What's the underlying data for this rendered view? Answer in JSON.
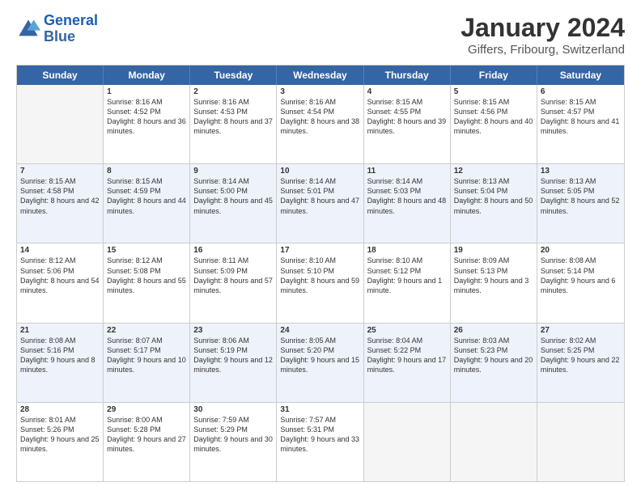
{
  "header": {
    "logo_line1": "General",
    "logo_line2": "Blue",
    "title": "January 2024",
    "subtitle": "Giffers, Fribourg, Switzerland"
  },
  "calendar": {
    "days": [
      "Sunday",
      "Monday",
      "Tuesday",
      "Wednesday",
      "Thursday",
      "Friday",
      "Saturday"
    ],
    "rows": [
      [
        {
          "num": "",
          "sunrise": "",
          "sunset": "",
          "daylight": "",
          "empty": true
        },
        {
          "num": "1",
          "sunrise": "Sunrise: 8:16 AM",
          "sunset": "Sunset: 4:52 PM",
          "daylight": "Daylight: 8 hours and 36 minutes."
        },
        {
          "num": "2",
          "sunrise": "Sunrise: 8:16 AM",
          "sunset": "Sunset: 4:53 PM",
          "daylight": "Daylight: 8 hours and 37 minutes."
        },
        {
          "num": "3",
          "sunrise": "Sunrise: 8:16 AM",
          "sunset": "Sunset: 4:54 PM",
          "daylight": "Daylight: 8 hours and 38 minutes."
        },
        {
          "num": "4",
          "sunrise": "Sunrise: 8:15 AM",
          "sunset": "Sunset: 4:55 PM",
          "daylight": "Daylight: 8 hours and 39 minutes."
        },
        {
          "num": "5",
          "sunrise": "Sunrise: 8:15 AM",
          "sunset": "Sunset: 4:56 PM",
          "daylight": "Daylight: 8 hours and 40 minutes."
        },
        {
          "num": "6",
          "sunrise": "Sunrise: 8:15 AM",
          "sunset": "Sunset: 4:57 PM",
          "daylight": "Daylight: 8 hours and 41 minutes."
        }
      ],
      [
        {
          "num": "7",
          "sunrise": "Sunrise: 8:15 AM",
          "sunset": "Sunset: 4:58 PM",
          "daylight": "Daylight: 8 hours and 42 minutes."
        },
        {
          "num": "8",
          "sunrise": "Sunrise: 8:15 AM",
          "sunset": "Sunset: 4:59 PM",
          "daylight": "Daylight: 8 hours and 44 minutes."
        },
        {
          "num": "9",
          "sunrise": "Sunrise: 8:14 AM",
          "sunset": "Sunset: 5:00 PM",
          "daylight": "Daylight: 8 hours and 45 minutes."
        },
        {
          "num": "10",
          "sunrise": "Sunrise: 8:14 AM",
          "sunset": "Sunset: 5:01 PM",
          "daylight": "Daylight: 8 hours and 47 minutes."
        },
        {
          "num": "11",
          "sunrise": "Sunrise: 8:14 AM",
          "sunset": "Sunset: 5:03 PM",
          "daylight": "Daylight: 8 hours and 48 minutes."
        },
        {
          "num": "12",
          "sunrise": "Sunrise: 8:13 AM",
          "sunset": "Sunset: 5:04 PM",
          "daylight": "Daylight: 8 hours and 50 minutes."
        },
        {
          "num": "13",
          "sunrise": "Sunrise: 8:13 AM",
          "sunset": "Sunset: 5:05 PM",
          "daylight": "Daylight: 8 hours and 52 minutes."
        }
      ],
      [
        {
          "num": "14",
          "sunrise": "Sunrise: 8:12 AM",
          "sunset": "Sunset: 5:06 PM",
          "daylight": "Daylight: 8 hours and 54 minutes."
        },
        {
          "num": "15",
          "sunrise": "Sunrise: 8:12 AM",
          "sunset": "Sunset: 5:08 PM",
          "daylight": "Daylight: 8 hours and 55 minutes."
        },
        {
          "num": "16",
          "sunrise": "Sunrise: 8:11 AM",
          "sunset": "Sunset: 5:09 PM",
          "daylight": "Daylight: 8 hours and 57 minutes."
        },
        {
          "num": "17",
          "sunrise": "Sunrise: 8:10 AM",
          "sunset": "Sunset: 5:10 PM",
          "daylight": "Daylight: 8 hours and 59 minutes."
        },
        {
          "num": "18",
          "sunrise": "Sunrise: 8:10 AM",
          "sunset": "Sunset: 5:12 PM",
          "daylight": "Daylight: 9 hours and 1 minute."
        },
        {
          "num": "19",
          "sunrise": "Sunrise: 8:09 AM",
          "sunset": "Sunset: 5:13 PM",
          "daylight": "Daylight: 9 hours and 3 minutes."
        },
        {
          "num": "20",
          "sunrise": "Sunrise: 8:08 AM",
          "sunset": "Sunset: 5:14 PM",
          "daylight": "Daylight: 9 hours and 6 minutes."
        }
      ],
      [
        {
          "num": "21",
          "sunrise": "Sunrise: 8:08 AM",
          "sunset": "Sunset: 5:16 PM",
          "daylight": "Daylight: 9 hours and 8 minutes."
        },
        {
          "num": "22",
          "sunrise": "Sunrise: 8:07 AM",
          "sunset": "Sunset: 5:17 PM",
          "daylight": "Daylight: 9 hours and 10 minutes."
        },
        {
          "num": "23",
          "sunrise": "Sunrise: 8:06 AM",
          "sunset": "Sunset: 5:19 PM",
          "daylight": "Daylight: 9 hours and 12 minutes."
        },
        {
          "num": "24",
          "sunrise": "Sunrise: 8:05 AM",
          "sunset": "Sunset: 5:20 PM",
          "daylight": "Daylight: 9 hours and 15 minutes."
        },
        {
          "num": "25",
          "sunrise": "Sunrise: 8:04 AM",
          "sunset": "Sunset: 5:22 PM",
          "daylight": "Daylight: 9 hours and 17 minutes."
        },
        {
          "num": "26",
          "sunrise": "Sunrise: 8:03 AM",
          "sunset": "Sunset: 5:23 PM",
          "daylight": "Daylight: 9 hours and 20 minutes."
        },
        {
          "num": "27",
          "sunrise": "Sunrise: 8:02 AM",
          "sunset": "Sunset: 5:25 PM",
          "daylight": "Daylight: 9 hours and 22 minutes."
        }
      ],
      [
        {
          "num": "28",
          "sunrise": "Sunrise: 8:01 AM",
          "sunset": "Sunset: 5:26 PM",
          "daylight": "Daylight: 9 hours and 25 minutes."
        },
        {
          "num": "29",
          "sunrise": "Sunrise: 8:00 AM",
          "sunset": "Sunset: 5:28 PM",
          "daylight": "Daylight: 9 hours and 27 minutes."
        },
        {
          "num": "30",
          "sunrise": "Sunrise: 7:59 AM",
          "sunset": "Sunset: 5:29 PM",
          "daylight": "Daylight: 9 hours and 30 minutes."
        },
        {
          "num": "31",
          "sunrise": "Sunrise: 7:57 AM",
          "sunset": "Sunset: 5:31 PM",
          "daylight": "Daylight: 9 hours and 33 minutes."
        },
        {
          "num": "",
          "sunrise": "",
          "sunset": "",
          "daylight": "",
          "empty": true
        },
        {
          "num": "",
          "sunrise": "",
          "sunset": "",
          "daylight": "",
          "empty": true
        },
        {
          "num": "",
          "sunrise": "",
          "sunset": "",
          "daylight": "",
          "empty": true
        }
      ]
    ]
  }
}
